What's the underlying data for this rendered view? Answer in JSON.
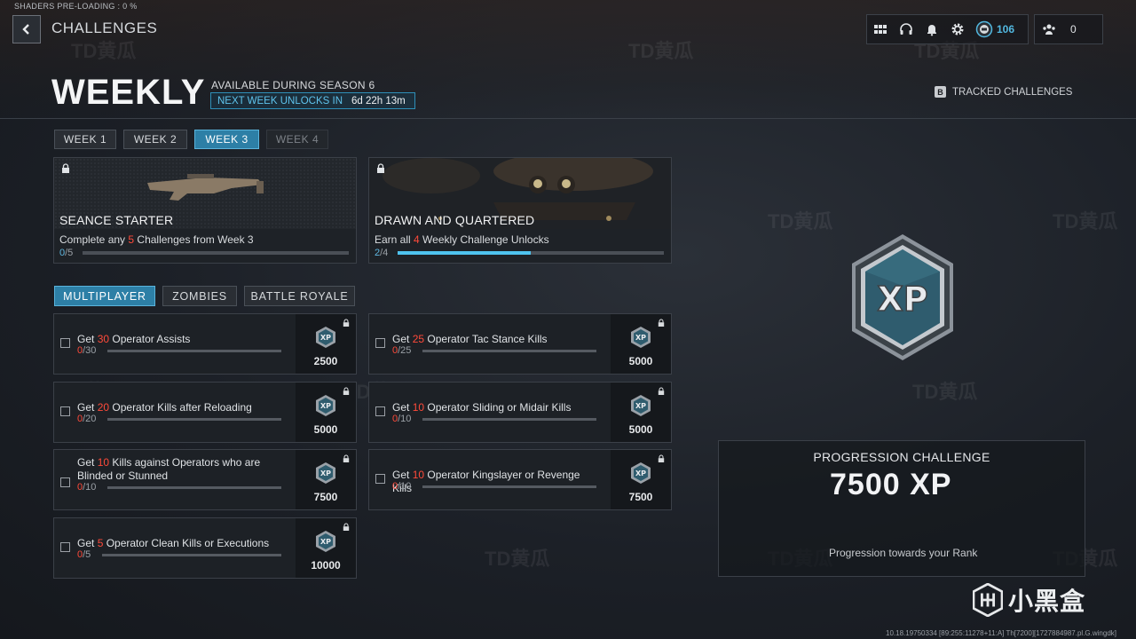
{
  "system": {
    "shaders_text": "SHADERS PRE-LOADING : 0 %"
  },
  "header": {
    "breadcrumb": "CHALLENGES",
    "cp_count": "106",
    "party_count": "0",
    "icons": [
      "back-arrow-icon",
      "grid-menu-icon",
      "headset-icon",
      "bell-icon",
      "gear-icon",
      "cod-points-icon",
      "party-icon"
    ]
  },
  "title": {
    "main": "WEEKLY",
    "season": "AVAILABLE DURING SEASON 6",
    "unlock_label": "NEXT WEEK UNLOCKS IN",
    "unlock_time": "6d 22h 13m",
    "tracked_key": "B",
    "tracked_label": "TRACKED CHALLENGES"
  },
  "week_tabs": [
    {
      "label": "WEEK 1",
      "state": "normal"
    },
    {
      "label": "WEEK 2",
      "state": "normal"
    },
    {
      "label": "WEEK 3",
      "state": "active"
    },
    {
      "label": "WEEK 4",
      "state": "disabled"
    }
  ],
  "featured": [
    {
      "title": "SEANCE STARTER",
      "desc_pre": "Complete any ",
      "desc_num": "5",
      "desc_post": " Challenges from Week 3",
      "progress_cur": "0",
      "progress_tot": "/5",
      "fraction": 0.0
    },
    {
      "title": "DRAWN AND QUARTERED",
      "desc_pre": "Earn all ",
      "desc_num": "4",
      "desc_post": " Weekly Challenge Unlocks",
      "progress_cur": "2",
      "progress_tot": "/4",
      "fraction": 0.5
    }
  ],
  "mode_tabs": [
    {
      "label": "MULTIPLAYER",
      "active": true
    },
    {
      "label": "ZOMBIES",
      "active": false
    },
    {
      "label": "BATTLE ROYALE",
      "active": false
    }
  ],
  "challenges": [
    {
      "pre": "Get ",
      "num": "30",
      "post": " Operator Assists",
      "cur": "0",
      "tot": "/30",
      "reward": "2500"
    },
    {
      "pre": "Get ",
      "num": "25",
      "post": " Operator Tac Stance Kills",
      "cur": "0",
      "tot": "/25",
      "reward": "5000"
    },
    {
      "pre": "Get ",
      "num": "20",
      "post": " Operator Kills after Reloading",
      "cur": "0",
      "tot": "/20",
      "reward": "5000"
    },
    {
      "pre": "Get ",
      "num": "10",
      "post": " Operator Sliding or Midair Kills",
      "cur": "0",
      "tot": "/10",
      "reward": "5000"
    },
    {
      "pre": "Get ",
      "num": "10",
      "post": " Kills against Operators who are Blinded or Stunned",
      "cur": "0",
      "tot": "/10",
      "reward": "7500"
    },
    {
      "pre": "Get ",
      "num": "10",
      "post": " Operator Kingslayer or Revenge Kills",
      "cur": "0",
      "tot": "/10",
      "reward": "7500"
    },
    {
      "pre": "Get ",
      "num": "5",
      "post": " Operator Clean Kills or Executions",
      "cur": "0",
      "tot": "/5",
      "reward": "10000"
    }
  ],
  "progression": {
    "title": "PROGRESSION CHALLENGE",
    "xp": "7500 XP",
    "desc": "Progression towards your Rank",
    "emblem_text": "XP"
  },
  "footer": {
    "build": "10.18.19750334 [89:255:11278+11:A] Th[7200][1727884987.pl.G.wingdk]",
    "brand": "小黑盒"
  },
  "watermark": "TD黄瓜",
  "colors": {
    "accent": "#2d7fa6",
    "highlight": "#ff4a3a",
    "progress": "#4fc3ef",
    "cp": "#52b8e0"
  }
}
